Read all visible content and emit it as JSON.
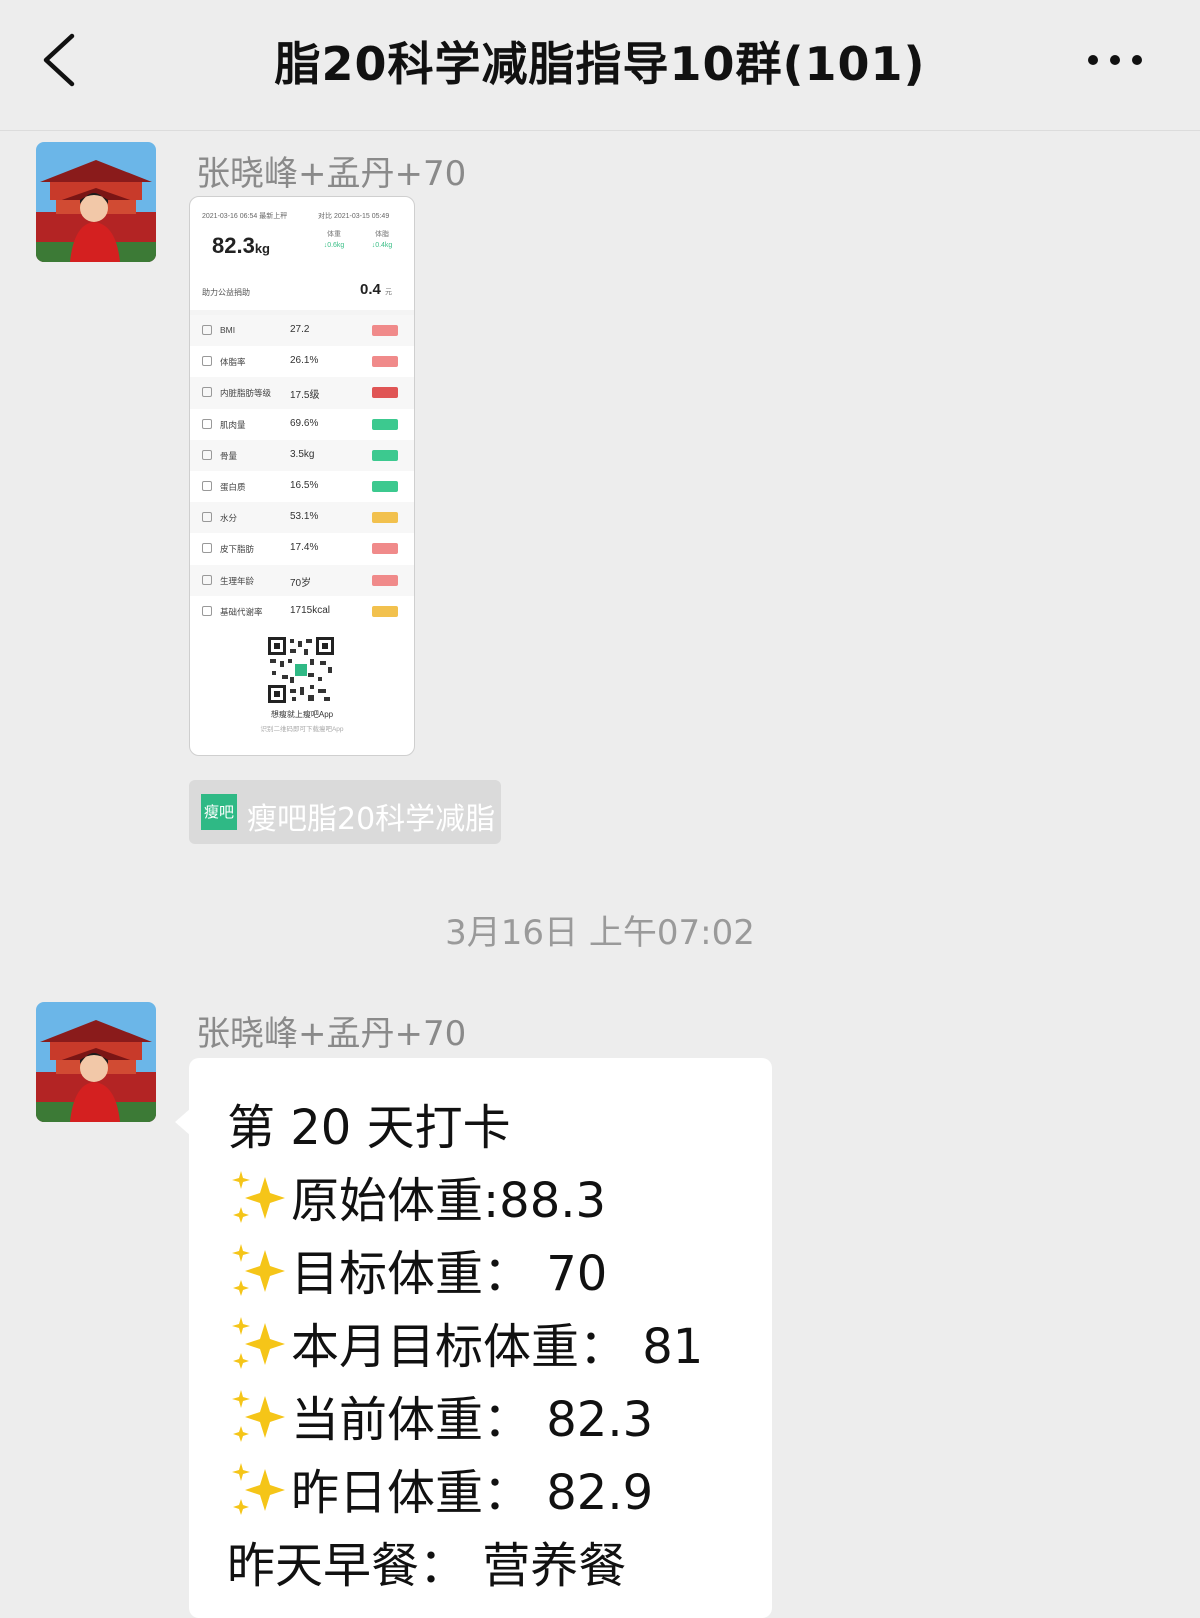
{
  "header": {
    "title": "脂20科学减脂指导10群(101)",
    "back_icon": "chevron-left-icon",
    "more_icon": "more-dots-icon"
  },
  "messages": [
    {
      "sender": "张晓峰+孟丹+70",
      "type": "image",
      "screenshot": {
        "time_left": "2021-03-16 06:54 最新上秤",
        "time_right": "对比 2021-03-15 05:49",
        "weight": "82.3",
        "weight_unit": "kg",
        "col1_label": "体重",
        "col1_delta": "↓0.6kg",
        "col2_label": "体脂",
        "col2_delta": "↓0.4kg",
        "donation_label": "助力公益捐助",
        "donation_value": "0.4",
        "donation_unit": "元",
        "rows": [
          {
            "name": "BMI",
            "value": "27.2",
            "status_color": "#f08a8a"
          },
          {
            "name": "体脂率",
            "value": "26.1%",
            "status_color": "#f08a8a"
          },
          {
            "name": "内脏脂肪等级",
            "value": "17.5级",
            "status_color": "#e05555"
          },
          {
            "name": "肌肉量",
            "value": "69.6%",
            "status_color": "#3cc98f"
          },
          {
            "name": "骨量",
            "value": "3.5kg",
            "status_color": "#3cc98f"
          },
          {
            "name": "蛋白质",
            "value": "16.5%",
            "status_color": "#3cc98f"
          },
          {
            "name": "水分",
            "value": "53.1%",
            "status_color": "#f2c14e"
          },
          {
            "name": "皮下脂肪",
            "value": "17.4%",
            "status_color": "#f08a8a"
          },
          {
            "name": "生理年龄",
            "value": "70岁",
            "status_color": "#f08a8a"
          },
          {
            "name": "基础代谢率",
            "value": "1715kcal",
            "status_color": "#f2c14e"
          }
        ],
        "qr_caption": "想瘦就上瘦吧App",
        "qr_subcaption": "识别二维码即可下载瘦吧App"
      }
    },
    {
      "type": "mini_app",
      "logo_text": "瘦吧",
      "label": "瘦吧脂20科学减脂"
    },
    {
      "type": "timestamp",
      "text": "3月16日 上午07:02"
    },
    {
      "sender": "张晓峰+孟丹+70",
      "type": "text",
      "lines": [
        "第     20 天打卡",
        "原始体重:88.3",
        "目标体重：  70",
        "本月目标体重：  81",
        "当前体重：  82.3",
        "昨日体重：  82.9",
        "昨天早餐：  营养餐"
      ],
      "sparkle_icon": "sparkles-emoji"
    }
  ]
}
